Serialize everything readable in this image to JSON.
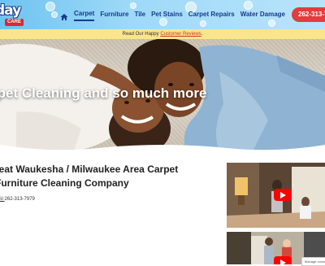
{
  "header": {
    "logo": {
      "main": "day",
      "sub": "CARE"
    },
    "nav": {
      "home_icon": "home-icon",
      "items": [
        "Carpet",
        "Furniture",
        "Tile",
        "Pet Stains",
        "Carpet Repairs",
        "Water Damage"
      ],
      "active": "Carpet"
    },
    "phone_button": "262-313-7"
  },
  "review_bar": {
    "prefix": "Read Our Happy ",
    "link": "Customer Reviews",
    "suffix": "."
  },
  "hero": {
    "title": "rpet Cleaning and so much more"
  },
  "main": {
    "heading": "reat Waukesha / Milwaukee Area Carpet Furniture Cleaning Company",
    "phone": "262-313-7979"
  },
  "manage_consent": "Manage consent",
  "colors": {
    "brand_blue": "#173a8c",
    "phone_red": "#e43c3c",
    "review_bar": "#fbe58c"
  }
}
